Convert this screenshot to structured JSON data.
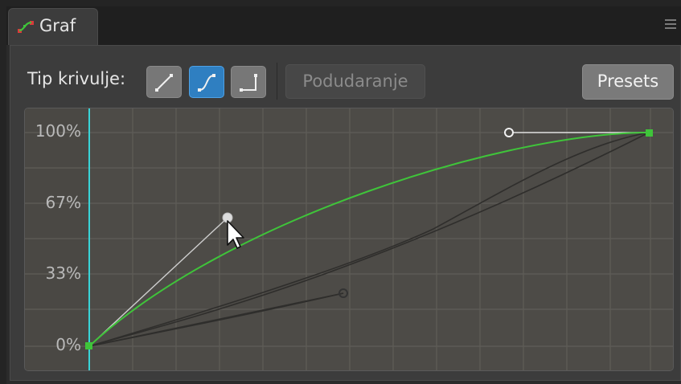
{
  "panel": {
    "tab_title": "Graf",
    "tab_icon": "graph-curve-icon",
    "menu_icon": "panel-menu-icon"
  },
  "toolbar": {
    "curve_type_label": "Tip krivulje:",
    "curve_buttons": [
      {
        "name": "linear-curve-icon",
        "active": false
      },
      {
        "name": "bezier-curve-icon",
        "active": true
      },
      {
        "name": "step-curve-icon",
        "active": false
      }
    ],
    "match_label": "Podudaranje",
    "presets_label": "Presets"
  },
  "graph": {
    "y_ticks": [
      "100%",
      "67%",
      "33%",
      "0%"
    ],
    "colors": {
      "curve": "#3fc43a",
      "playhead": "#3fd3d8",
      "grid": "#5d5b56",
      "background": "#4d4b47",
      "keyframe": "#3fc43a"
    }
  }
}
